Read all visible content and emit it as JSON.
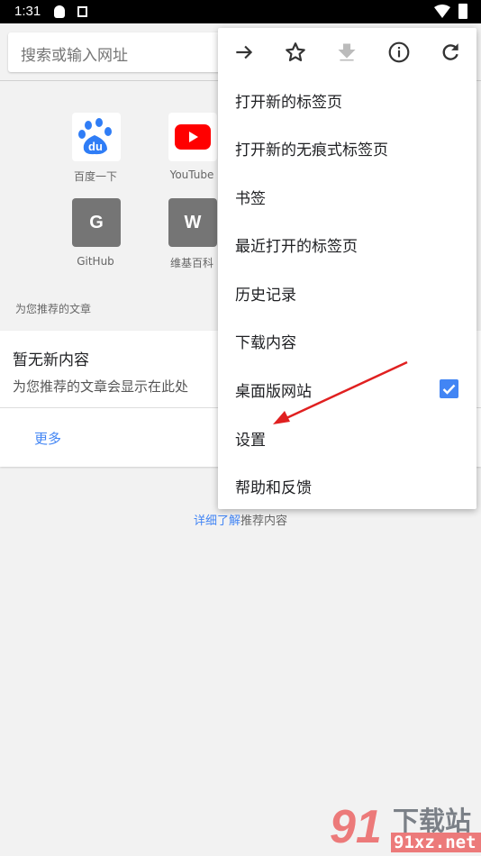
{
  "status_bar": {
    "time": "1:31"
  },
  "search": {
    "placeholder": "搜索或输入网址"
  },
  "shortcuts": [
    {
      "label": "百度一下",
      "icon": "baidu-icon"
    },
    {
      "label": "YouTube",
      "icon": "youtube-icon"
    },
    {
      "label": "GitHub",
      "letter": "G"
    },
    {
      "label": "维基百科",
      "letter": "W"
    }
  ],
  "feed": {
    "section_label": "为您推荐的文章",
    "title": "暂无新内容",
    "subtitle": "为您推荐的文章会显示在此处",
    "more": "更多",
    "learn_link": "详细了解",
    "learn_rest": "推荐内容"
  },
  "menu": {
    "icons": [
      "forward-icon",
      "star-icon",
      "download-icon",
      "info-icon",
      "refresh-icon"
    ],
    "items": [
      "打开新的标签页",
      "打开新的无痕式标签页",
      "书签",
      "最近打开的标签页",
      "历史记录",
      "下载内容",
      "桌面版网站",
      "设置",
      "帮助和反馈"
    ],
    "desktop_site_checked": true
  },
  "watermark": {
    "text1": "下载站",
    "text2": "91xz.net",
    "logo": "91"
  },
  "colors": {
    "accent": "#4285f4",
    "arrow": "#e02020"
  }
}
